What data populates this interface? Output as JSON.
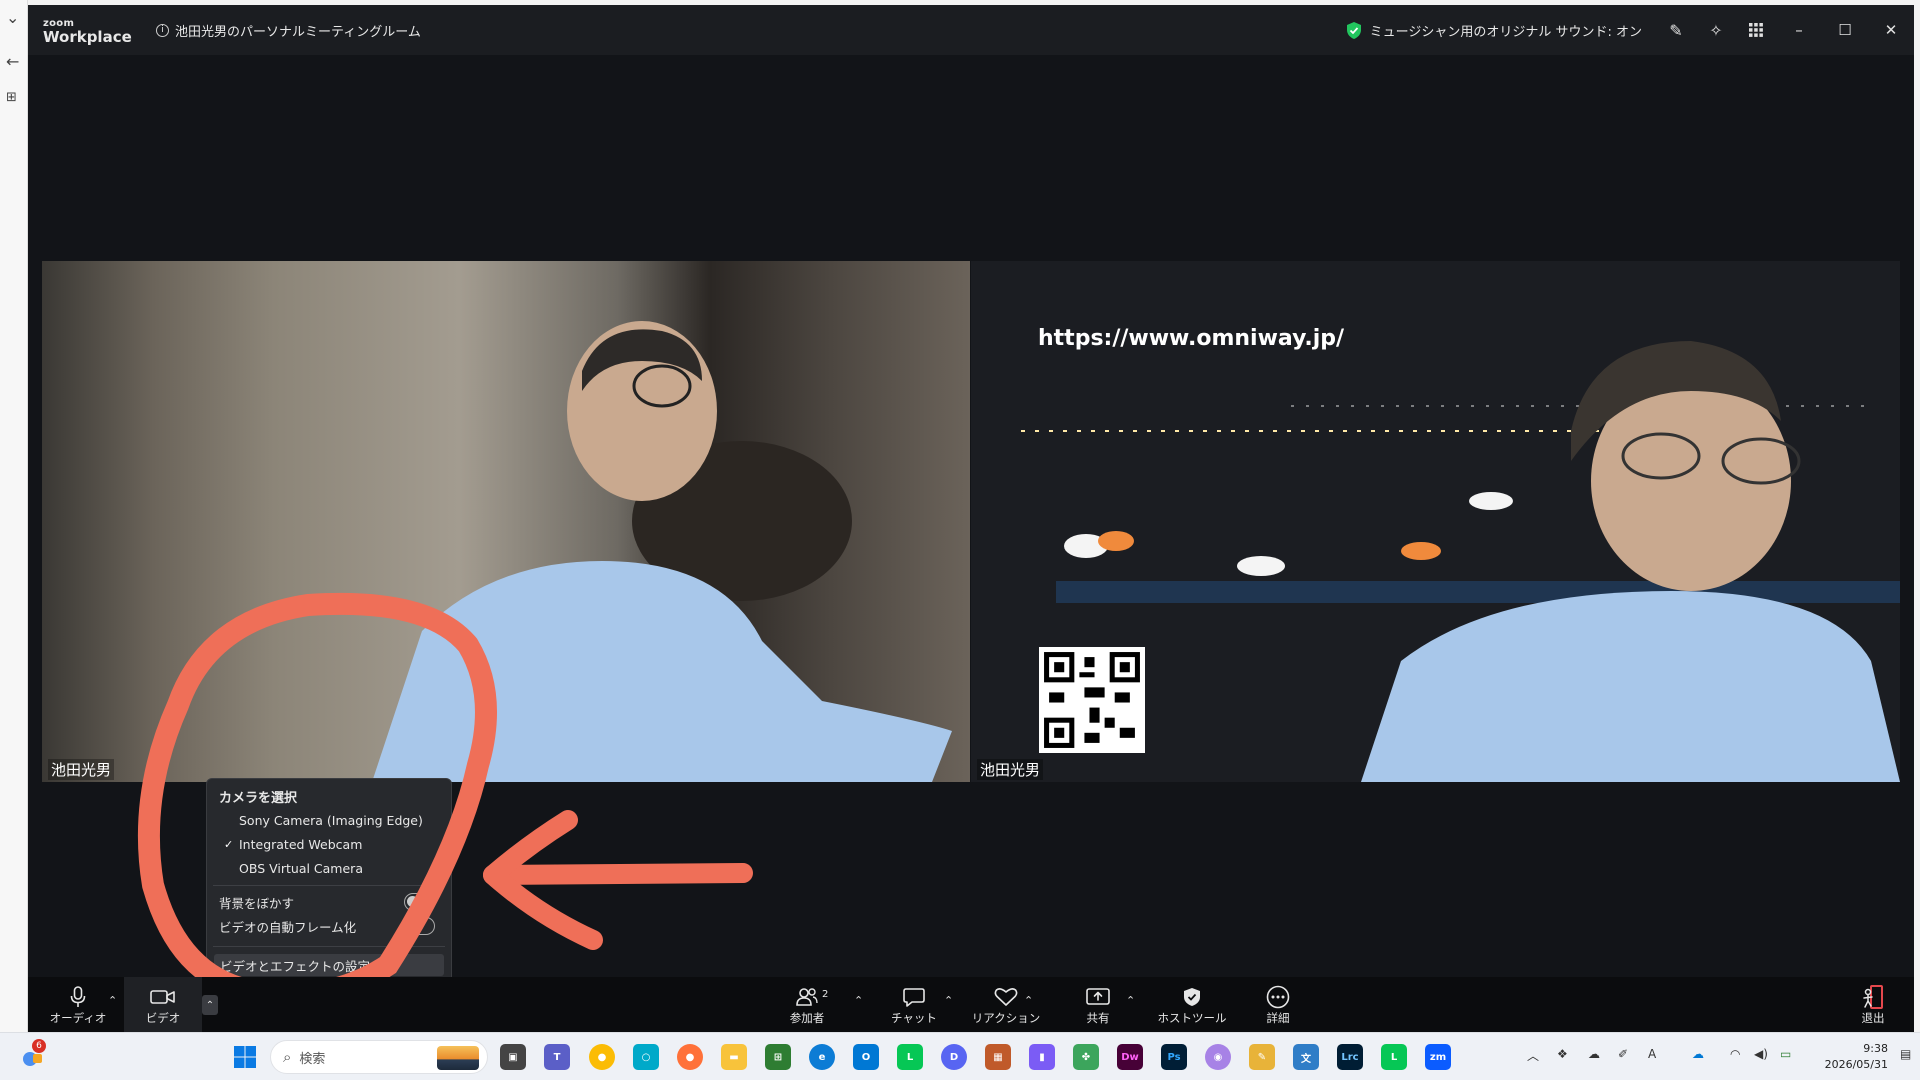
{
  "titlebar": {
    "logo_small": "zoom",
    "logo_main": "Workplace",
    "meeting_title": "池田光男のパーソナルミーティングルーム",
    "music_sound": "ミュージシャン用のオリジナル サウンド: オン"
  },
  "videos": [
    {
      "name": "池田光男"
    },
    {
      "name": "池田光男",
      "overlay_url": "https://www.omniway.jp/"
    }
  ],
  "camera_menu": {
    "title": "カメラを選択",
    "options": [
      {
        "label": "Sony Camera (Imaging Edge)",
        "checked": false
      },
      {
        "label": "Integrated Webcam",
        "checked": true
      },
      {
        "label": "OBS Virtual Camera",
        "checked": false
      }
    ],
    "toggles": [
      {
        "label": "背景をぼかす",
        "on": false
      },
      {
        "label": "ビデオの自動フレーム化",
        "on": false
      }
    ],
    "settings_button": "ビデオとエフェクトの設定"
  },
  "toolbar": {
    "audio": "オーディオ",
    "video": "ビデオ",
    "participants": "参加者",
    "participants_count": "2",
    "chat": "チャット",
    "reactions": "リアクション",
    "share": "共有",
    "host_tools": "ホストツール",
    "more": "詳細",
    "leave": "退出"
  },
  "taskbar": {
    "search_placeholder": "検索",
    "notification_badge": "6",
    "time": "9:38",
    "date": "2026/05/31"
  },
  "colors": {
    "annotation": "#ef6f58",
    "zoom_bg": "#121418",
    "toolbar_bg": "#0b0c0e"
  }
}
